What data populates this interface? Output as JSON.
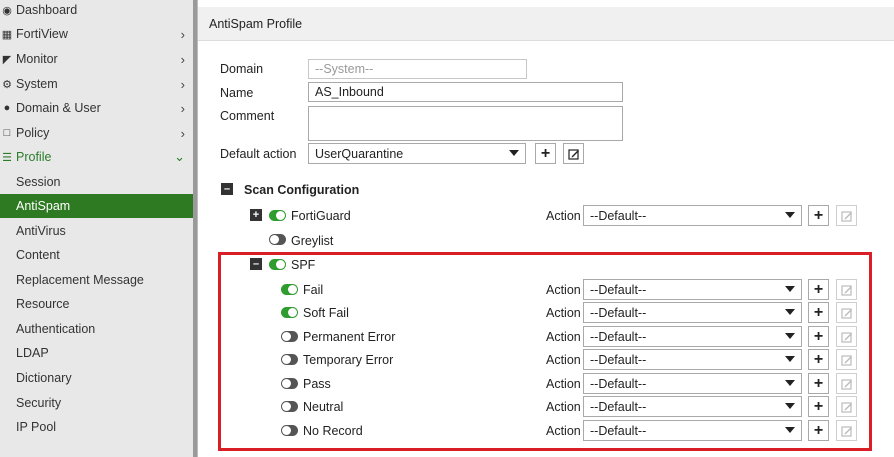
{
  "sidebar": {
    "items": [
      {
        "label": "Dashboard",
        "icon": "dashboard-icon"
      },
      {
        "label": "FortiView",
        "icon": "chart-icon"
      },
      {
        "label": "Monitor",
        "icon": "monitor-icon"
      },
      {
        "label": "System",
        "icon": "gear-icon"
      },
      {
        "label": "Domain & User",
        "icon": "user-icon"
      },
      {
        "label": "Policy",
        "icon": "document-icon"
      },
      {
        "label": "Profile",
        "icon": "list-icon"
      },
      {
        "label": "Session"
      },
      {
        "label": "AntiSpam"
      },
      {
        "label": "AntiVirus"
      },
      {
        "label": "Content"
      },
      {
        "label": "Replacement Message"
      },
      {
        "label": "Resource"
      },
      {
        "label": "Authentication"
      },
      {
        "label": "LDAP"
      },
      {
        "label": "Dictionary"
      },
      {
        "label": "Security"
      },
      {
        "label": "IP Pool"
      }
    ]
  },
  "dialog": {
    "title": "AntiSpam Profile",
    "domain_label": "Domain",
    "domain_placeholder": "--System--",
    "name_label": "Name",
    "name_value": "AS_Inbound",
    "comment_label": "Comment",
    "comment_value": "",
    "default_action_label": "Default action",
    "default_action_value": "UserQuarantine",
    "scan_config_label": "Scan Configuration",
    "fortiguard_label": "FortiGuard",
    "greylist_label": "Greylist",
    "spf_label": "SPF",
    "action_label": "Action",
    "default_option": "--Default--",
    "spf_items": [
      {
        "label": "Fail",
        "on": true
      },
      {
        "label": "Soft Fail",
        "on": true
      },
      {
        "label": "Permanent Error",
        "on": false
      },
      {
        "label": "Temporary Error",
        "on": false
      },
      {
        "label": "Pass",
        "on": false
      },
      {
        "label": "Neutral",
        "on": false
      },
      {
        "label": "No Record",
        "on": false
      }
    ]
  },
  "colors": {
    "brand_green": "#2e7a22",
    "toggle_on": "#2e9c2e",
    "highlight_red": "#d91e25"
  }
}
